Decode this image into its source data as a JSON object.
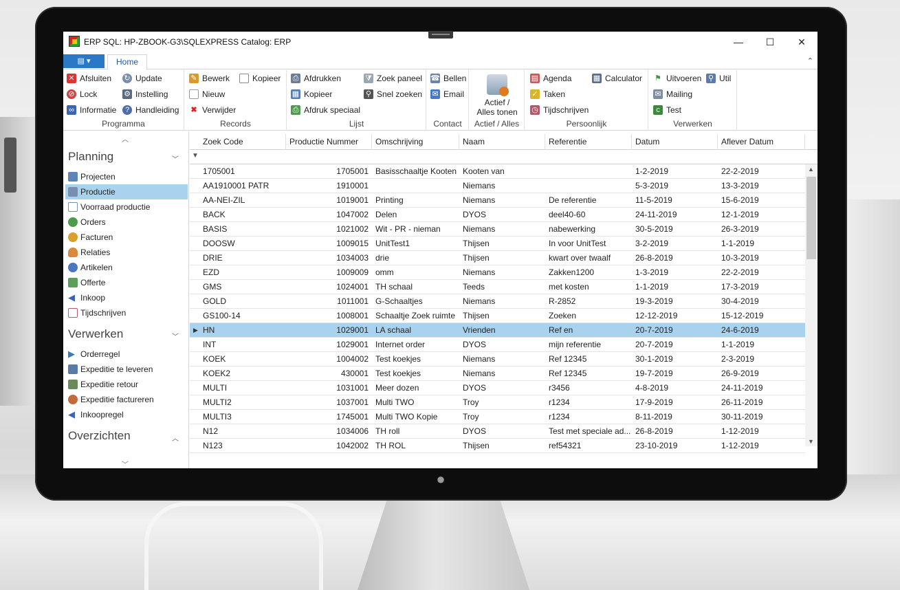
{
  "window": {
    "title": "ERP SQL: HP-ZBOOK-G3\\SQLEXPRESS  Catalog: ERP",
    "minimize": "—",
    "maximize": "☐",
    "close": "✕"
  },
  "ribbon": {
    "file_button": "▤ ▾",
    "tab_home": "Home",
    "collapse": "⌃",
    "groups": {
      "programma": {
        "label": "Programma",
        "afsluiten": "Afsluiten",
        "lock": "Lock",
        "informatie": "Informatie",
        "update": "Update",
        "instelling": "Instelling",
        "handleiding": "Handleiding"
      },
      "records": {
        "label": "Records",
        "bewerk": "Bewerk",
        "nieuw": "Nieuw",
        "verwijder": "Verwijder",
        "kopieer": "Kopieer"
      },
      "lijst": {
        "label": "Lijst",
        "afdrukken": "Afdrukken",
        "kopieer": "Kopieer",
        "afdruk_speciaal": "Afdruk speciaal",
        "zoek_paneel": "Zoek paneel",
        "snel_zoeken": "Snel zoeken"
      },
      "contact": {
        "label": "Contact",
        "bellen": "Bellen",
        "email": "Email"
      },
      "actief": {
        "label": "Actief / Alles",
        "big_line1": "Actief /",
        "big_line2": "Alles tonen"
      },
      "persoonlijk": {
        "label": "Persoonlijk",
        "agenda": "Agenda",
        "taken": "Taken",
        "tijdschrijven": "Tijdschrijven",
        "calculator": "Calculator"
      },
      "verwerken": {
        "label": "Verwerken",
        "uitvoeren": "Uitvoeren",
        "mailing": "Mailing",
        "test": "Test",
        "util": "Util"
      }
    }
  },
  "nav": {
    "sections": {
      "planning": "Planning",
      "verwerken": "Verwerken",
      "overzichten": "Overzichten"
    },
    "planning_items": [
      "Projecten",
      "Productie",
      "Voorraad productie",
      "Orders",
      "Facturen",
      "Relaties",
      "Artikelen",
      "Offerte",
      "Inkoop",
      "Tijdschrijven"
    ],
    "verwerken_items": [
      "Orderregel",
      "Expeditie te leveren",
      "Expeditie retour",
      "Expeditie factureren",
      "Inkoopregel"
    ],
    "selected": "Productie"
  },
  "grid": {
    "columns": [
      "Zoek Code",
      "Productie Nummer",
      "Omschrijving",
      "Naam",
      "Referentie",
      "Datum",
      "Aflever Datum"
    ],
    "filter_icon": "▼",
    "selected_row_marker": "▶",
    "rows": [
      [
        "1705001",
        "1705001",
        "Basisschaaltje Kooten",
        "Kooten van",
        "",
        "1-2-2019",
        "22-2-2019"
      ],
      [
        "AA1910001 PATR",
        "1910001",
        "",
        "Niemans",
        "",
        "5-3-2019",
        "13-3-2019"
      ],
      [
        "AA-NEI-ZIL",
        "1019001",
        "Printing",
        "Niemans",
        "De referentie",
        "11-5-2019",
        "15-6-2019"
      ],
      [
        "BACK",
        "1047002",
        "Delen",
        "DYOS",
        "deel40-60",
        "24-11-2019",
        "12-1-2019"
      ],
      [
        "BASIS",
        "1021002",
        "Wit - PR - nieman",
        "Niemans",
        "nabewerking",
        "30-5-2019",
        "26-3-2019"
      ],
      [
        "DOOSW",
        "1009015",
        "UnitTest1",
        "Thijsen",
        "In voor UnitTest",
        "3-2-2019",
        "1-1-2019"
      ],
      [
        "DRIE",
        "1034003",
        "drie",
        "Thijsen",
        "kwart over twaalf",
        "26-8-2019",
        "10-3-2019"
      ],
      [
        "EZD",
        "1009009",
        "omm",
        "Niemans",
        "Zakken1200",
        "1-3-2019",
        "22-2-2019"
      ],
      [
        "GMS",
        "1024001",
        "TH schaal",
        "Teeds",
        "met kosten",
        "1-1-2019",
        "17-3-2019"
      ],
      [
        "GOLD",
        "1011001",
        "G-Schaaltjes",
        "Niemans",
        "R-2852",
        "19-3-2019",
        "30-4-2019"
      ],
      [
        "GS100-14",
        "1008001",
        "Schaaltje Zoek ruimte",
        "Thijsen",
        "Zoeken",
        "12-12-2019",
        "15-12-2019"
      ],
      [
        "HN",
        "1029001",
        "LA schaal",
        "Vrienden",
        "Ref en",
        "20-7-2019",
        "24-6-2019"
      ],
      [
        "INT",
        "1029001",
        "Internet order",
        "DYOS",
        "mijn referentie",
        "20-7-2019",
        "1-1-2019"
      ],
      [
        "KOEK",
        "1004002",
        "Test koekjes",
        "Niemans",
        "Ref 12345",
        "30-1-2019",
        "2-3-2019"
      ],
      [
        "KOEK2",
        "430001",
        "Test koekjes",
        "Niemans",
        "Ref 12345",
        "19-7-2019",
        "26-9-2019"
      ],
      [
        "MULTI",
        "1031001",
        "Meer dozen",
        "DYOS",
        "r3456",
        "4-8-2019",
        "24-11-2019"
      ],
      [
        "MULTI2",
        "1037001",
        "Multi TWO",
        "Troy",
        "r1234",
        "17-9-2019",
        "26-11-2019"
      ],
      [
        "MULTI3",
        "1745001",
        "Multi TWO Kopie",
        "Troy",
        "r1234",
        "8-11-2019",
        "30-11-2019"
      ],
      [
        "N12",
        "1034006",
        "TH roll",
        "DYOS",
        "Test met speciale ad...",
        "26-8-2019",
        "1-12-2019"
      ],
      [
        "N123",
        "1042002",
        "TH ROL",
        "Thijsen",
        "ref54321",
        "23-10-2019",
        "1-12-2019"
      ]
    ],
    "selected_row_index": 11
  },
  "colors": {
    "selection": "#a9d2ee",
    "accent": "#2b78c6",
    "tab_text": "#1e5aa8"
  }
}
